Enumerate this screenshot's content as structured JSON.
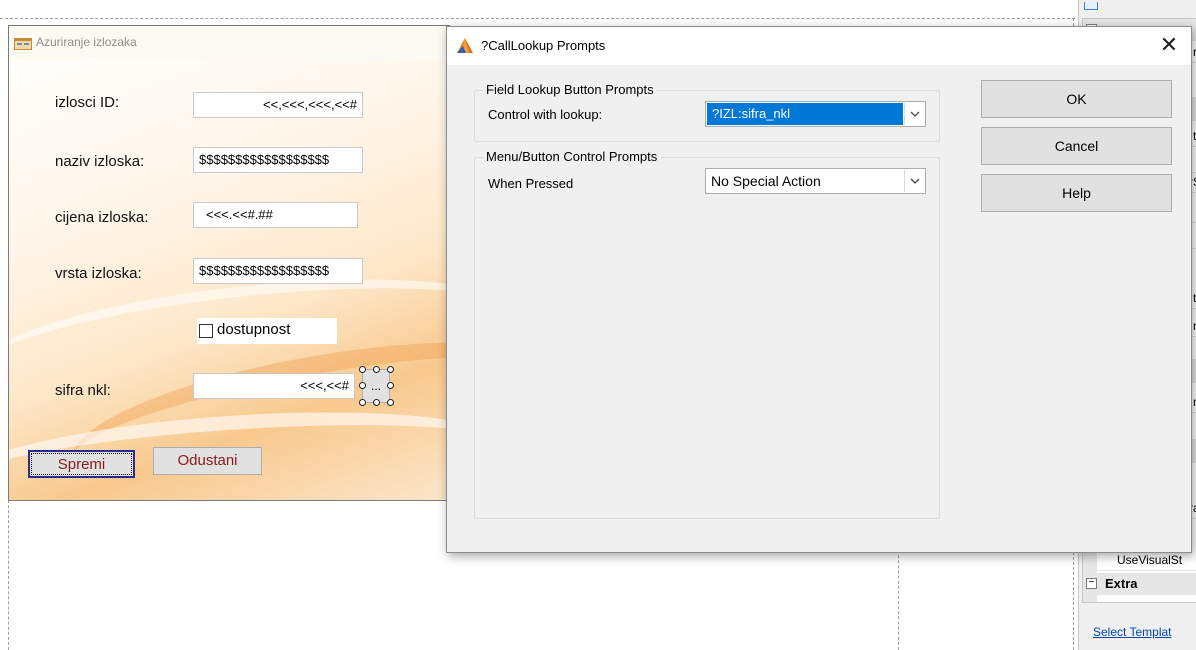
{
  "form_window": {
    "title": "Azuriranje izlozaka",
    "fields": [
      {
        "label": "izlosci ID:",
        "value": "<<,<<<,<<<,<<#"
      },
      {
        "label": "naziv izloska:",
        "value": "$$$$$$$$$$$$$$$$$$"
      },
      {
        "label": "cijena izloska:",
        "value": "<<<.<<#.##"
      },
      {
        "label": "vrsta izloska:",
        "value": "$$$$$$$$$$$$$$$$$$"
      }
    ],
    "checkbox_label": "dostupnost",
    "sifra_label": "sifra nkl:",
    "sifra_value": "<<<,<<#",
    "lookup_button_label": "...",
    "save_label": "Spremi",
    "cancel_label": "Odustani"
  },
  "dialog": {
    "title": "?CallLookup Prompts",
    "close_glyph": "✕",
    "group1_title": "Field Lookup Button Prompts",
    "control_with_lookup_label": "Control with lookup:",
    "control_with_lookup_value": "?IZL:sifra_nkl",
    "group2_title": "Menu/Button Control Prompts",
    "when_pressed_label": "When Pressed",
    "when_pressed_value": "No Special Action",
    "ok_label": "OK",
    "cancel_label": "Cancel",
    "help_label": "Help"
  },
  "property_panel": {
    "fragments": [
      "r",
      "t",
      "rS",
      "t",
      "n",
      "n",
      "ra"
    ],
    "use_visual_label": "UseVisualSt",
    "extra_category": "Extra",
    "select_template_link": "Select Templat"
  },
  "colors": {
    "selection_blue": "#0078d7",
    "form_button_text": "#8b1a1a",
    "link_blue": "#0645ad"
  },
  "icons": {
    "form_app_icon": "app-window-icon",
    "dialog_icon": "clarion-triangle-icon",
    "close": "close-icon",
    "dropdown": "chevron-down-icon"
  }
}
